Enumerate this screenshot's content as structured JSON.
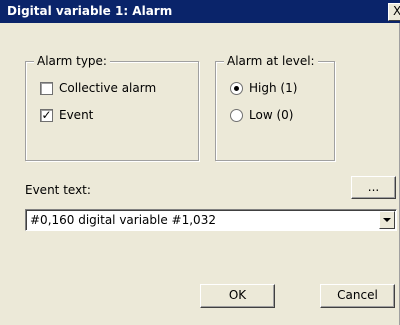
{
  "window": {
    "title": "Digital variable 1: Alarm",
    "close_glyph": "X"
  },
  "alarm_type": {
    "legend": "Alarm type:",
    "options": [
      {
        "label": "Collective alarm",
        "checked": false
      },
      {
        "label": "Event",
        "checked": true
      }
    ]
  },
  "alarm_level": {
    "legend": "Alarm at level:",
    "options": [
      {
        "label": "High (1)",
        "selected": true
      },
      {
        "label": "Low (0)",
        "selected": false
      }
    ]
  },
  "event_text": {
    "label": "Event text:",
    "browse_label": "...",
    "value": "#0,160 digital variable #1,032"
  },
  "buttons": {
    "ok": "OK",
    "cancel": "Cancel"
  },
  "colors": {
    "titlebar": "#0a246a",
    "face": "#ece9d8"
  }
}
